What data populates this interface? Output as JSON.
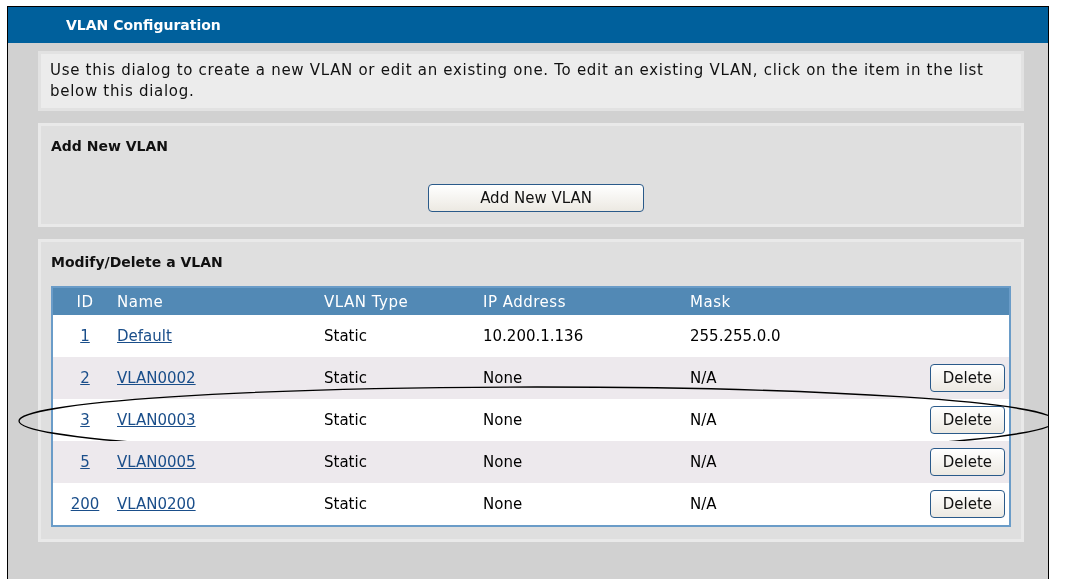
{
  "window": {
    "title": "VLAN Configuration"
  },
  "intro": "Use this dialog to create a new VLAN or edit an existing one. To edit an existing VLAN, click on the item in the list below this dialog.",
  "add_section": {
    "title": "Add New VLAN",
    "button": "Add New VLAN"
  },
  "modify_section": {
    "title": "Modify/Delete a VLAN",
    "table": {
      "columns": [
        "ID",
        "Name",
        "VLAN Type",
        "IP Address",
        "Mask"
      ],
      "rows": [
        {
          "id": "1",
          "name": "Default",
          "type": "Static",
          "ip": "10.200.1.136",
          "mask": "255.255.0.0",
          "highlighted": false
        },
        {
          "id": "2",
          "name": "VLAN0002",
          "type": "Static",
          "ip": "None",
          "mask": "N/A",
          "delete": "Delete",
          "highlighted": false
        },
        {
          "id": "3",
          "name": "VLAN0003",
          "type": "Static",
          "ip": "None",
          "mask": "N/A",
          "delete": "Delete",
          "highlighted": true
        },
        {
          "id": "5",
          "name": "VLAN0005",
          "type": "Static",
          "ip": "None",
          "mask": "N/A",
          "delete": "Delete",
          "highlighted": false
        },
        {
          "id": "200",
          "name": "VLAN0200",
          "type": "Static",
          "ip": "None",
          "mask": "N/A",
          "delete": "Delete",
          "highlighted": false
        }
      ]
    }
  }
}
